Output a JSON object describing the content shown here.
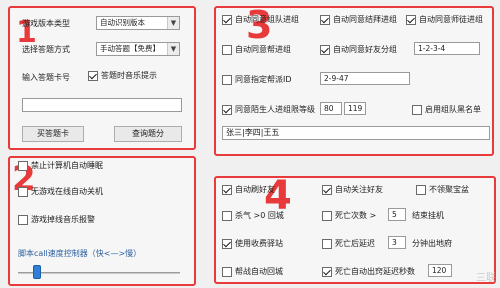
{
  "panel1": {
    "number": "1",
    "version_label": "游戏版本类型",
    "version_value": "自动识别版本",
    "answer_mode_label": "选择答题方式",
    "answer_mode_value": "手动答题【免费】",
    "card_label": "输入答题卡号",
    "tip_checkbox": {
      "label": "答题时音乐提示",
      "checked": true
    },
    "card_input": "",
    "buy_button": "买答题卡",
    "query_button": "查询题分"
  },
  "panel2": {
    "number": "2",
    "checkboxes": [
      {
        "label": "禁止计算机自动睡眠",
        "checked": false
      },
      {
        "label": "无游戏在线自动关机",
        "checked": false
      },
      {
        "label": "游戏掉线音乐报警",
        "checked": false
      }
    ],
    "speed_label": "脚本call速度控制器（快<—>慢）",
    "speed_level": 0.1
  },
  "panel3": {
    "number": "3",
    "row1": [
      {
        "label": "自动同意组队进组",
        "checked": true
      },
      {
        "label": "自动同意结拜进组",
        "checked": true
      },
      {
        "label": "自动同意师徒进组",
        "checked": true
      }
    ],
    "row2": [
      {
        "label": "自动同意帮进组",
        "checked": false
      },
      {
        "label": "自动同意好友分组",
        "checked": true
      }
    ],
    "row2_input": "1-2-3-4",
    "designated_id": {
      "label": "同意指定帮派ID",
      "checked": false,
      "value": "2-9-47"
    },
    "stranger": {
      "label": "同意陌生人进组限等级",
      "checked": true,
      "min": "80",
      "max": "119"
    },
    "blacklist": {
      "label": "启用组队黑名单",
      "checked": false
    },
    "names_input": "张三|李四|王五"
  },
  "panel4": {
    "number": "4",
    "col1": [
      {
        "label": "自动刷好友",
        "checked": true
      },
      {
        "label": "杀气 >0 回城",
        "checked": false
      },
      {
        "label": "使用收费驿站",
        "checked": true
      },
      {
        "label": "帮战自动回城",
        "checked": false
      }
    ],
    "col2": [
      {
        "label": "自动关注好友",
        "checked": true
      },
      {
        "label": "死亡次数 >",
        "checked": false
      },
      {
        "label": "死亡后延迟",
        "checked": false
      },
      {
        "label": "死亡自动出窍延迟秒数",
        "checked": true
      }
    ],
    "col3_top": {
      "label": "不领聚宝盆",
      "checked": false
    },
    "death_count": "5",
    "death_count_suffix": "结束挂机",
    "death_delay": "3",
    "death_delay_suffix": "分钟出地府",
    "out_delay": "120"
  },
  "watermark": "三联",
  "colors": {
    "accent": "#e83a3a",
    "slider": "#2d7fd8"
  }
}
